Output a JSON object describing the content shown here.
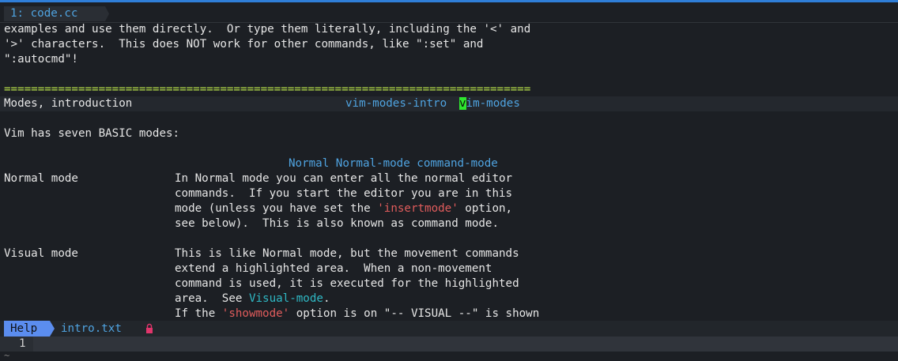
{
  "tab": {
    "number": "1:",
    "name": "code.cc"
  },
  "lines": {
    "l1": "examples and use them directly.  Or type them literally, including the '<' and",
    "l2": "'>' characters.  This does NOT work for other commands, like \":set\" and",
    "l3": "\":autocmd\"!",
    "separator": "==============================================================================",
    "heading_left": "Modes, introduction",
    "heading_tag1": "vim-modes-intro",
    "heading_tag2_cursor": "v",
    "heading_tag2_rest": "im-modes",
    "seven": "Vim has seven BASIC modes:",
    "tags_row": "Normal Normal-mode command-mode",
    "normal_label": "Normal mode",
    "normal_1": "In Normal mode you can enter all the normal editor",
    "normal_2": "commands.  If you start the editor you are in this",
    "normal_3_pre": "mode (unless you have set the ",
    "normal_3_opt": "'insertmode'",
    "normal_3_post": " option,",
    "normal_4": "see below).  This is also known as command mode.",
    "visual_label": "Visual mode",
    "visual_1": "This is like Normal mode, but the movement commands",
    "visual_2": "extend a highlighted area.  When a non-movement",
    "visual_3": "command is used, it is executed for the highlighted",
    "visual_4_pre": "area.  See ",
    "visual_4_link": "Visual-mode",
    "visual_4_post": ".",
    "visual_5_pre": "If the ",
    "visual_5_opt": "'showmode'",
    "visual_5_post": " option is on \"-- VISUAL --\" is shown"
  },
  "status": {
    "mode": "Help",
    "file": "intro.txt",
    "lock_icon": "lock-icon"
  },
  "cmdline": {
    "line_number": "1"
  },
  "tilde": "~",
  "colors": {
    "accent": "#5b8def",
    "tag": "#4fa3e0",
    "option": "#e05c5c",
    "link": "#2fb8c4",
    "cursor": "#2ee62e",
    "separator": "#b9e04a"
  }
}
